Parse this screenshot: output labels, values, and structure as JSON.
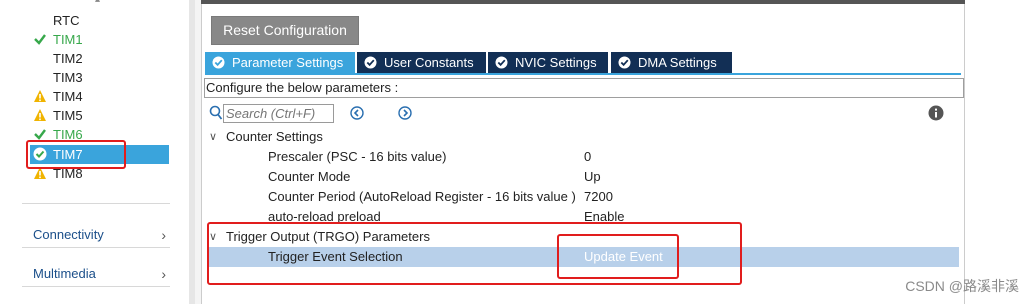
{
  "sidebar": {
    "items": [
      {
        "label": "RTC",
        "status": "none"
      },
      {
        "label": "TIM1",
        "status": "ok"
      },
      {
        "label": "TIM2",
        "status": "none"
      },
      {
        "label": "TIM3",
        "status": "none"
      },
      {
        "label": "TIM4",
        "status": "warning"
      },
      {
        "label": "TIM5",
        "status": "warning"
      },
      {
        "label": "TIM6",
        "status": "ok"
      },
      {
        "label": "TIM7",
        "status": "selected-ok"
      },
      {
        "label": "TIM8",
        "status": "warning"
      }
    ],
    "groups": [
      {
        "label": "Connectivity"
      },
      {
        "label": "Multimedia"
      }
    ]
  },
  "toolbar": {
    "reset_label": "Reset Configuration"
  },
  "tabs": [
    {
      "label": "Parameter Settings",
      "active": true
    },
    {
      "label": "User Constants",
      "active": false
    },
    {
      "label": "NVIC Settings",
      "active": false
    },
    {
      "label": "DMA Settings",
      "active": false
    }
  ],
  "config_hint": "Configure the below parameters :",
  "search": {
    "placeholder": "Search (Ctrl+F)"
  },
  "sections": [
    {
      "title": "Counter Settings",
      "params": [
        {
          "name": "Prescaler (PSC - 16 bits value)",
          "value": "0"
        },
        {
          "name": "Counter Mode",
          "value": "Up"
        },
        {
          "name": "Counter Period (AutoReload Register - 16 bits value )",
          "value": "7200"
        },
        {
          "name": "auto-reload preload",
          "value": "Enable"
        }
      ]
    },
    {
      "title": "Trigger Output (TRGO) Parameters",
      "params": [
        {
          "name": "Trigger Event Selection",
          "value": "Update Event"
        }
      ]
    }
  ],
  "watermark": "CSDN @路溪非溪",
  "colors": {
    "accent": "#3aa4dc",
    "tab_dark": "#122f55",
    "ok": "#37a84b",
    "warning": "#f0b400",
    "annotation": "#e11d1d"
  }
}
